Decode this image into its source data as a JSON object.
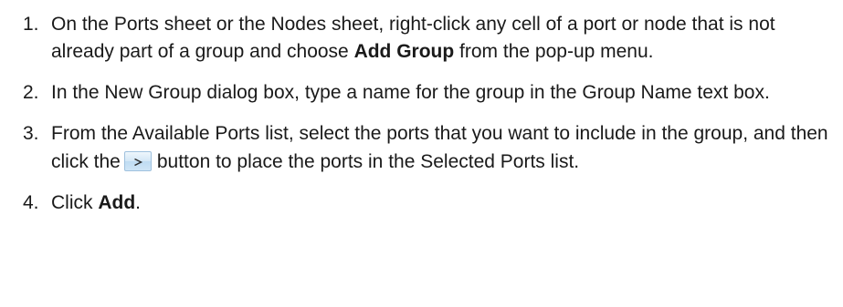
{
  "steps": [
    {
      "number": "1.",
      "part1": "On the Ports sheet or the Nodes sheet, right-click any cell of a port or node that is not already part of a group and choose ",
      "bold": "Add Group",
      "part2": " from the pop-up menu."
    },
    {
      "number": "2.",
      "text": "In the New Group dialog box, type a name for the group in the Group Name text box."
    },
    {
      "number": "3.",
      "part1": "From the Available Ports list, select the ports that you want to include in the group, and then click the",
      "button_icon": "chevron-right-icon",
      "part2": "button to place the ports in the Selected Ports list."
    },
    {
      "number": "4.",
      "part1": "Click ",
      "bold": "Add",
      "part2": "."
    }
  ]
}
